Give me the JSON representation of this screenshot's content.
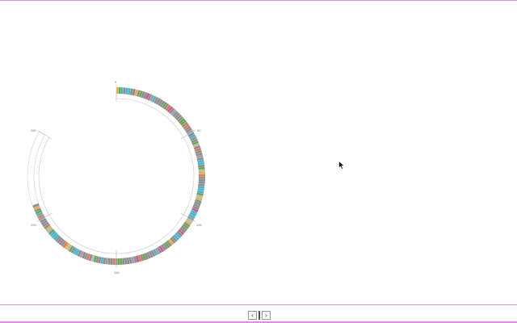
{
  "plasmid_map": {
    "start_label": "0",
    "tick_labels": [
      "50",
      "100",
      "150",
      "200",
      "250"
    ],
    "feature_colors": [
      "#8e8e8e",
      "#8e8e8e",
      "#4fb3c8",
      "#8e8e8e",
      "#6aa84f",
      "#8e8e8e",
      "#e0785a",
      "#8e8e8e",
      "#9e9e9e",
      "#4fb3c8",
      "#8e8e8e",
      "#b7b7b7",
      "#6aa84f",
      "#8e8e8e",
      "#c75b9b",
      "#8e8e8e",
      "#4fb3c8",
      "#8e8e8e",
      "#d9b44a",
      "#8e8e8e"
    ],
    "leading_colors": [
      "#d9b44a",
      "#6aa84f",
      "#4fb3c8"
    ]
  },
  "pager": {
    "prev_label": "‹",
    "next_label": "›"
  }
}
